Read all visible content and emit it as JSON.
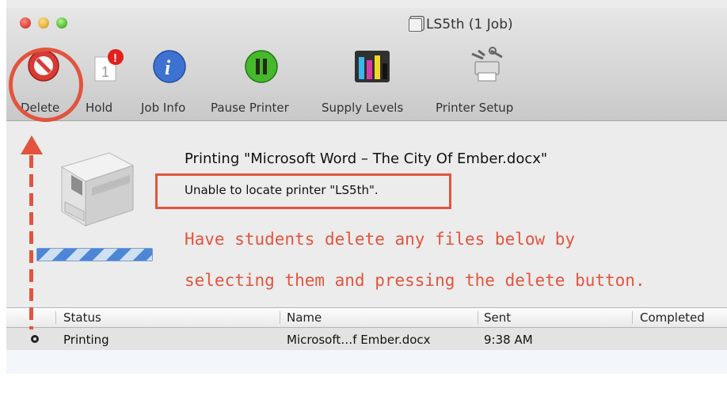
{
  "window": {
    "title": "LS5th (1 Job)"
  },
  "toolbar": {
    "items": [
      {
        "label": "Delete",
        "icon": "delete-no-icon"
      },
      {
        "label": "Hold",
        "icon": "hold-calendar-icon"
      },
      {
        "label": "Job Info",
        "icon": "info-icon"
      },
      {
        "label": "Pause Printer",
        "icon": "pause-icon"
      },
      {
        "label": "Supply Levels",
        "icon": "ink-levels-icon"
      },
      {
        "label": "Printer Setup",
        "icon": "printer-setup-icon"
      }
    ]
  },
  "job": {
    "title": "Printing \"Microsoft Word – The City Of Ember.docx\"",
    "status": "Unable to locate printer \"LS5th\"."
  },
  "annotation": {
    "line1": "Have students delete any files below by",
    "line2": "selecting them and pressing the delete button."
  },
  "table": {
    "columns": [
      "Status",
      "Name",
      "Sent",
      "Completed"
    ],
    "rows": [
      {
        "status": "Printing",
        "name": "Microsoft…f Ember.docx",
        "sent": "9:38 AM",
        "completed": ""
      }
    ]
  },
  "colors": {
    "annotation": "#e2543e",
    "accent": "#4d86d6"
  }
}
